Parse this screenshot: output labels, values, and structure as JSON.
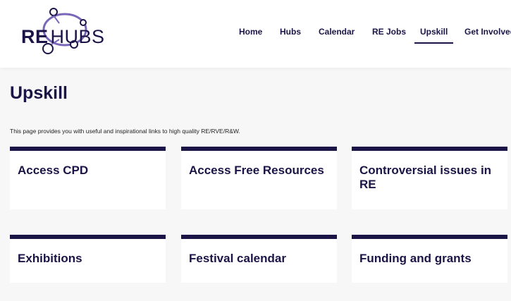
{
  "logo": {
    "re": "RE",
    "hubs": "HUBS"
  },
  "nav": [
    {
      "label": "Home",
      "active": false
    },
    {
      "label": "Hubs",
      "active": false
    },
    {
      "label": "Calendar",
      "active": false
    },
    {
      "label": "RE Jobs",
      "active": false
    },
    {
      "label": "Upskill",
      "active": true
    },
    {
      "label": "Get Involved",
      "active": false
    }
  ],
  "page": {
    "title": "Upskill",
    "intro": "This page provides you with useful and inspirational links to high quality RE/RVE/R&W."
  },
  "cards": [
    {
      "title": "Access CPD"
    },
    {
      "title": "Access Free Resources"
    },
    {
      "title": "Controversial issues in RE"
    },
    {
      "title": "Exhibitions"
    },
    {
      "title": "Festival calendar"
    },
    {
      "title": "Funding and grants"
    }
  ],
  "colors": {
    "brand": "#1b1547",
    "logo_accent": "#7b67b8",
    "background": "#f7f7f8",
    "card": "#ffffff"
  }
}
